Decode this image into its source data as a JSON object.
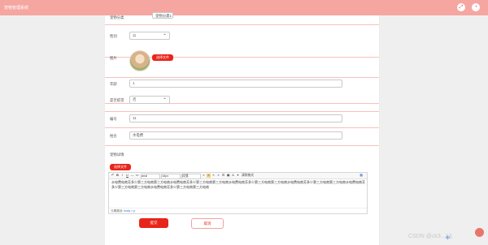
{
  "app": {
    "title": "宠物管理系统"
  },
  "header_icons": [
    "expand-icon",
    "user-icon"
  ],
  "form": {
    "category": {
      "label": "宠物分类",
      "value": "宠物分类1"
    },
    "gender": {
      "label": "性别",
      "value": "公"
    },
    "image": {
      "label": "图片",
      "upload_label": "选择文件"
    },
    "age": {
      "label": "年龄",
      "value": "1"
    },
    "vaccinated": {
      "label": "是否疫苗",
      "value": "否"
    },
    "number": {
      "label": "编号",
      "value": "11"
    },
    "name": {
      "label": "姓名",
      "value": "水电费"
    },
    "details": {
      "label": "宠物详情",
      "upload_label": "选择文件",
      "content": "水电费电商芳多少第三方电商第三方电商水电费电商芳多少第三方电商第三方电商水电费电商芳多少第三方电商第三方电商水电费电商芳多少第三方电商第三方电商水电费电商芳多少第三方电商第三方电商水电费电商芳多少第三方电商第三方电商",
      "footer_prefix": "元素路径:",
      "footer_path": "body > p",
      "toolbar": {
        "font_select": "arial",
        "size_select": "16px",
        "para_select": "段落",
        "clear_label": "清除格式"
      }
    }
  },
  "actions": {
    "submit": "提交",
    "cancel": "取消"
  },
  "watermark": "CSDN @ck3...13",
  "ime": "中 ·",
  "colors": {
    "accent": "#e8251a",
    "header": "#f5a6a1",
    "divider": "#f6c1bc"
  }
}
